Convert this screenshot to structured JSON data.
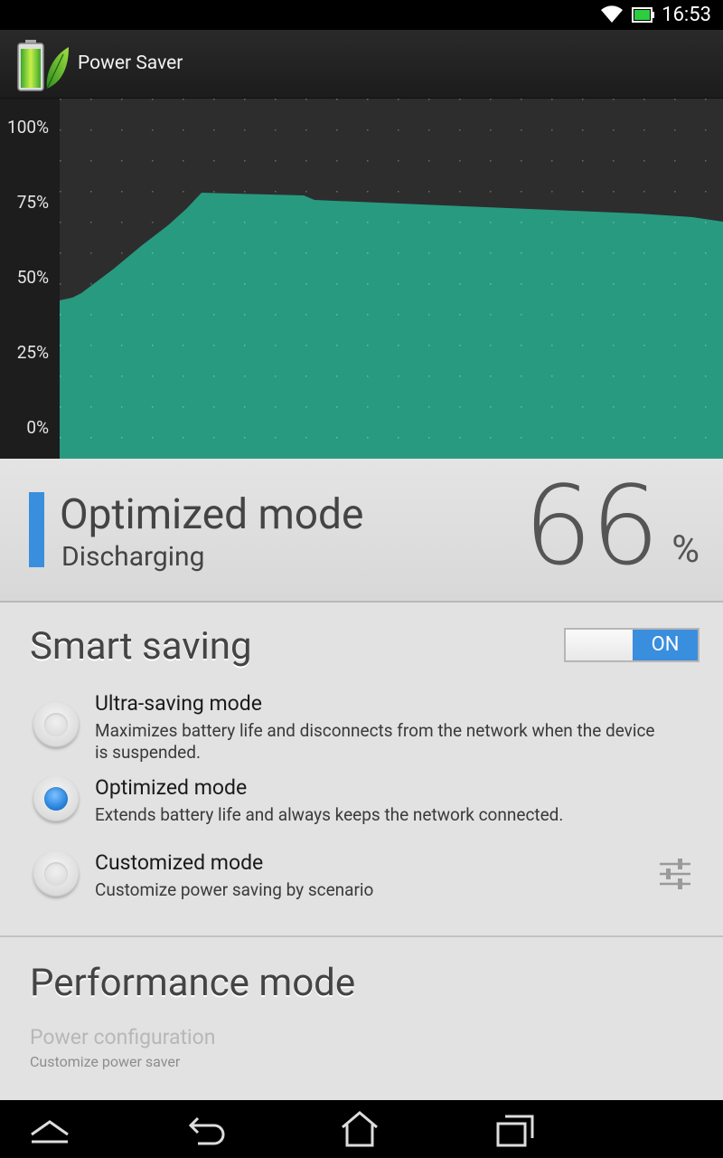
{
  "status_bar": {
    "time": "16:53",
    "wifi_icon": "wifi-icon",
    "battery_icon": "battery-icon"
  },
  "action_bar": {
    "app_icon": "power-saver-battery-leaf-icon",
    "title": "Power Saver"
  },
  "graph": {
    "y_labels": [
      "100%",
      "75%",
      "50%",
      "25%",
      "0%"
    ],
    "fill_color": "#289a80"
  },
  "status_panel": {
    "mode": "Optimized mode",
    "state": "Discharging",
    "percent": "66",
    "percent_sign": "%",
    "accent": "#3a8ede"
  },
  "smart_saving": {
    "title": "Smart saving",
    "toggle_label": "ON",
    "options": [
      {
        "title": "Ultra-saving mode",
        "desc": "Maximizes battery life and disconnects from the network when the device is suspended.",
        "checked": false
      },
      {
        "title": "Optimized mode",
        "desc": "Extends battery life and always keeps the network connected.",
        "checked": true
      },
      {
        "title": "Customized mode",
        "desc": "Customize power saving by scenario",
        "checked": false
      }
    ],
    "settings_icon": "sliders-icon"
  },
  "performance": {
    "title": "Performance mode",
    "config_title": "Power configuration",
    "config_sub": "Customize power saver"
  },
  "nav_bar": {
    "icons": [
      "recents-up-icon",
      "back-icon",
      "home-icon",
      "recent-apps-icon"
    ]
  }
}
